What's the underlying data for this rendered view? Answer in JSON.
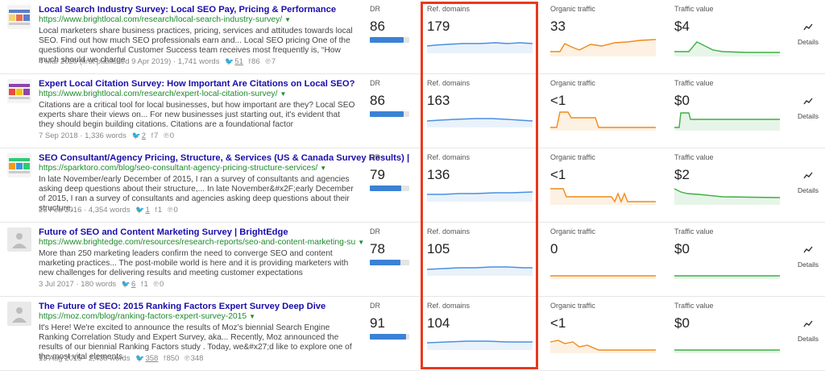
{
  "columns": {
    "dr": "DR",
    "ref_domains": "Ref. domains",
    "organic_traffic": "Organic traffic",
    "traffic_value": "Traffic value",
    "details": "Details"
  },
  "rows": [
    {
      "thumb": "image",
      "title": "Local Search Industry Survey: Local SEO Pay, Pricing & Performance",
      "url": "https://www.brightlocal.com/research/local-search-industry-survey/",
      "snippet": "Local marketers share business practices, pricing, services and attitudes towards local SEO. Find out how much SEO professionals earn and... Local SEO pricing One of the questions our wonderful Customer Success team receives most frequently is, “How much should we charge",
      "date": "4 Mar 2020 (first published 9 Apr 2019)",
      "words": "1,741 words",
      "twitter": "51",
      "facebook": "86",
      "pinterest": "7",
      "dr": "86",
      "dr_fill": 0.86,
      "ref_domains": "179",
      "organic_traffic": "33",
      "traffic_value": "$4"
    },
    {
      "thumb": "image",
      "title": "Expert Local Citation Survey: How Important Are Citations on Local SEO?",
      "url": "https://www.brightlocal.com/research/expert-local-citation-survey/",
      "snippet": "Citations are a critical tool for local businesses, but how important are they? Local SEO experts share their views on... For new businesses just starting out, it's evident that they should begin building citations. Citations are a foundational factor",
      "date": "7 Sep 2018",
      "words": "1,336 words",
      "twitter": "2",
      "facebook": "7",
      "pinterest": "0",
      "dr": "86",
      "dr_fill": 0.86,
      "ref_domains": "163",
      "organic_traffic": "<1",
      "traffic_value": "$0"
    },
    {
      "thumb": "image",
      "title": "SEO Consultant/Agency Pricing, Structure, & Services (US & Canada Survey Results) |",
      "url": "https://sparktoro.com/blog/seo-consultant-agency-pricing-structure-services/",
      "snippet": "In late November/early December of 2015, I ran a survey of consultants and agencies asking deep questions about their structure,... In late November&#x2F;early December of 2015, I ran a survey of consultants and agencies asking deep questions about their structure,",
      "date": "26 Feb 2016",
      "words": "4,354 words",
      "twitter": "1",
      "facebook": "1",
      "pinterest": "0",
      "dr": "79",
      "dr_fill": 0.79,
      "ref_domains": "136",
      "organic_traffic": "<1",
      "traffic_value": "$2"
    },
    {
      "thumb": "placeholder",
      "title": "Future of SEO and Content Marketing Survey | BrightEdge",
      "url": "https://www.brightedge.com/resources/research-reports/seo-and-content-marketing-su",
      "snippet": "More than 250 marketing leaders confirm the need to converge SEO and content marketing practices... The post-mobile world is here and it is providing marketers with new challenges for delivering results and meeting customer expectations",
      "date": "3 Jul 2017",
      "words": "180 words",
      "twitter": "6",
      "facebook": "1",
      "pinterest": "0",
      "dr": "78",
      "dr_fill": 0.78,
      "ref_domains": "105",
      "organic_traffic": "0",
      "traffic_value": "$0"
    },
    {
      "thumb": "placeholder",
      "title": "The Future of SEO: 2015 Ranking Factors Expert Survey Deep Dive",
      "url": "https://moz.com/blog/ranking-factors-expert-survey-2015",
      "snippet": "It's Here! We're excited to announce the results of Moz's biennial Search Engine Ranking Correlation Study and Expert Survey, aka... Recently, Moz announced the results of our biennial Ranking Factors study . Today, we&#x27;d like to explore one of the most vital elements",
      "date": "13 Aug 2015",
      "words": "2,438 words",
      "twitter": "358",
      "facebook": "850",
      "pinterest": "348",
      "dr": "91",
      "dr_fill": 0.91,
      "ref_domains": "104",
      "organic_traffic": "<1",
      "traffic_value": "$0"
    }
  ],
  "colors": {
    "title": "#1a0dab",
    "url": "#1e8a2e",
    "dr_bar": "#3a82d6",
    "ref_line": "#4a90e2",
    "organic_line": "#f28a1a",
    "value_line": "#3cb043",
    "highlight_border": "#e8391d"
  },
  "icons": {
    "twitter": "twitter-icon",
    "facebook": "facebook-icon",
    "pinterest": "pinterest-icon",
    "details": "trend-icon",
    "url_caret": "caret-down-icon"
  }
}
